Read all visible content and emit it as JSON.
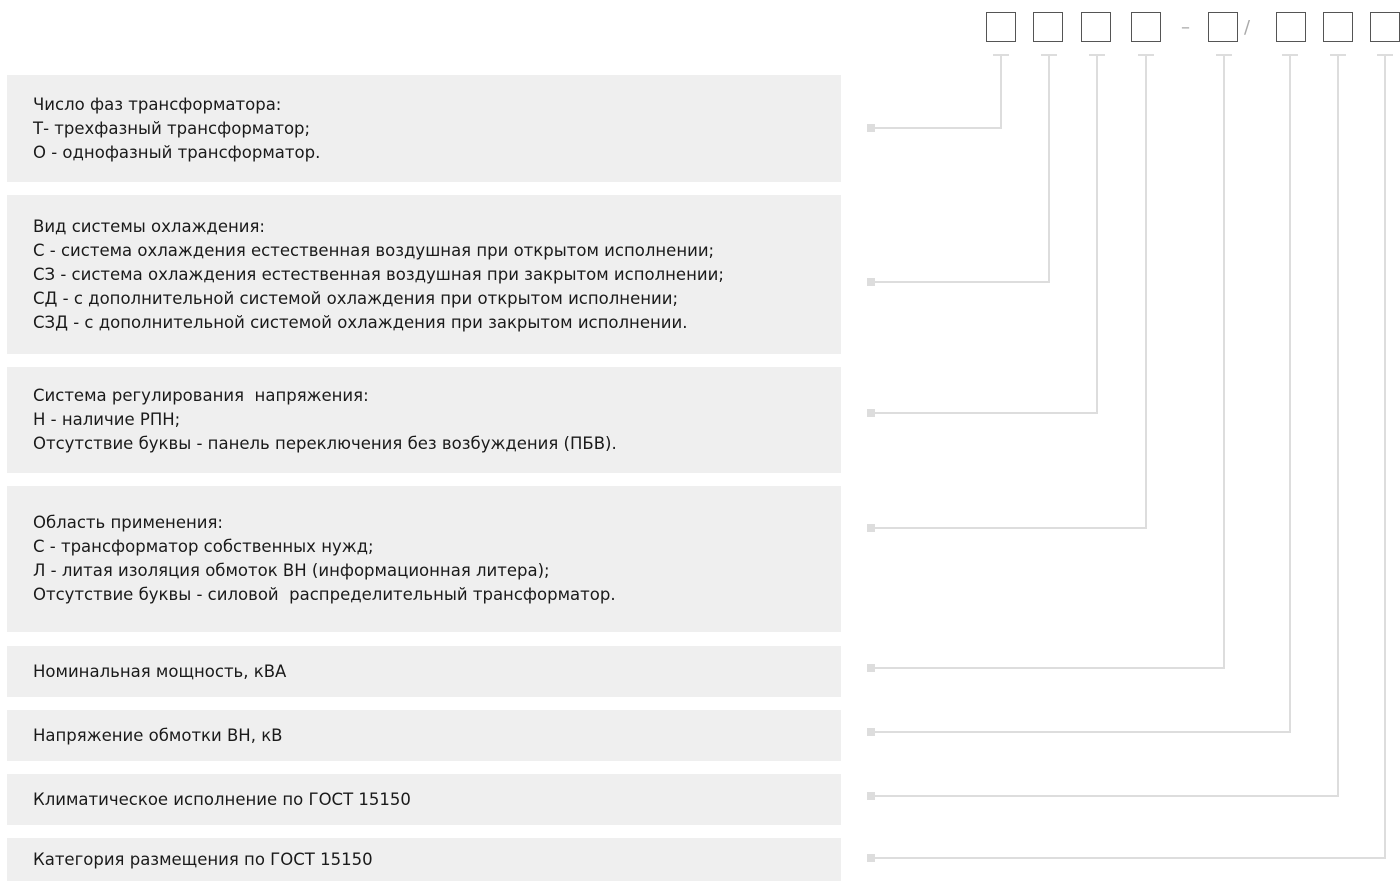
{
  "code_separators": {
    "dash": "–",
    "slash": "/"
  },
  "code_slots": [
    "slot-1",
    "slot-2",
    "slot-3",
    "slot-4",
    "slot-5",
    "slot-6",
    "slot-7",
    "slot-8"
  ],
  "descriptions": [
    {
      "lines": [
        "Число фаз трансформатора:",
        "Т- трехфазный трансформатор;",
        "О - однофазный трансформатор."
      ]
    },
    {
      "lines": [
        "Вид системы охлаждения:",
        "С - система охлаждения естественная воздушная при открытом исполнении;",
        "СЗ - система охлаждения естественная воздушная при закрытом исполнении;",
        "СД - с дополнительной системой охлаждения при открытом исполнении;",
        "СЗД - с дополнительной системой охлаждения при закрытом исполнении."
      ]
    },
    {
      "lines": [
        "Система регулирования  напряжения:",
        "Н - наличие РПН;",
        "Отсутствие буквы - панель переключения без возбуждения (ПБВ)."
      ]
    },
    {
      "lines": [
        "Область применения:",
        "С - трансформатор собственных нужд;",
        "Л - литая изоляция обмоток ВН (информационная литера);",
        "Отсутствие буквы - силовой  распределительный трансформатор."
      ]
    },
    {
      "lines": [
        "Номинальная мощность, кВА"
      ]
    },
    {
      "lines": [
        "Напряжение обмотки ВН, кВ"
      ]
    },
    {
      "lines": [
        "Климатическое исполнение по ГОСТ 15150"
      ]
    },
    {
      "lines": [
        "Категория размещения по ГОСТ 15150"
      ]
    }
  ],
  "colors": {
    "panel_background": "#efefef",
    "connector_line": "#dddddd",
    "box_border": "#555555",
    "separator": "#aaaaaa"
  }
}
